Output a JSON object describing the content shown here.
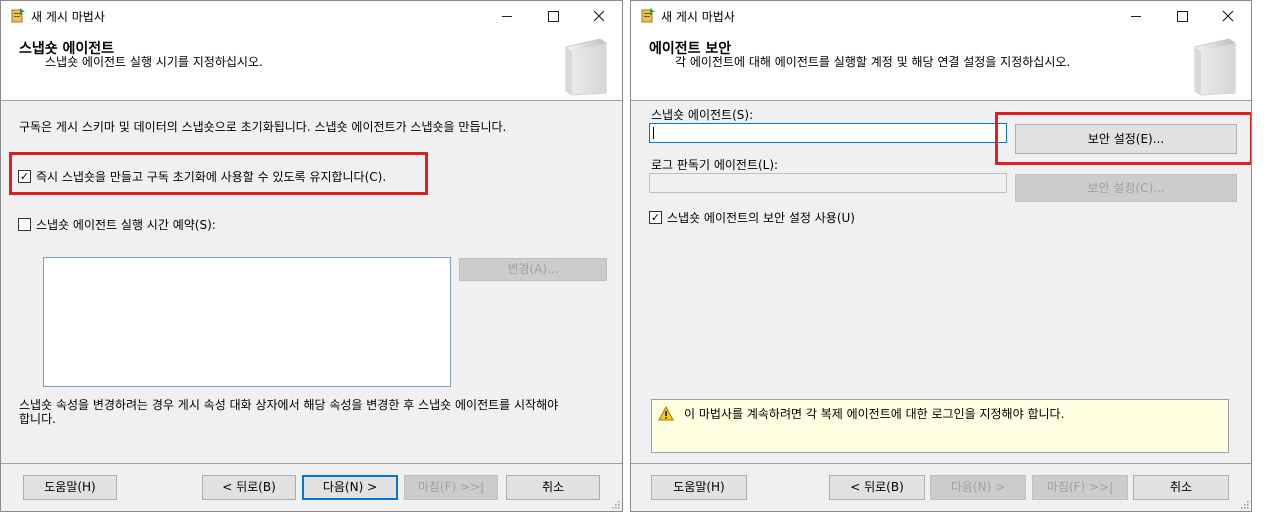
{
  "left": {
    "title": "새 게시 마법사",
    "header_title": "스냅숏 에이전트",
    "header_subtitle": "스냅숏 에이전트 실행 시기를 지정하십시오.",
    "description": "구독은 게시 스키마 및 데이터의 스냅숏으로 초기화됩니다. 스냅숏 에이전트가 스냅숏을 만듭니다.",
    "checkbox_immediate": {
      "label": "즉시 스냅숏을 만들고 구독 초기화에 사용할 수 있도록 유지합니다(C).",
      "checked": true,
      "mark": "✓"
    },
    "checkbox_schedule": {
      "label": "스냅숏 에이전트 실행 시간 예약(S):",
      "checked": false,
      "mark": ""
    },
    "change_button": "변경(A)...",
    "note_line1": "스냅숏 속성을 변경하려는 경우 게시 속성 대화 상자에서 해당 속성을 변경한 후 스냅숏 에이전트를 시작해야",
    "note_line2": "합니다.",
    "buttons": {
      "help": "도움말(H)",
      "back": "< 뒤로(B)",
      "next": "다음(N) >",
      "finish": "마침(F) >>|",
      "cancel": "취소"
    }
  },
  "right": {
    "title": "새 게시 마법사",
    "header_title": "에이전트 보안",
    "header_subtitle": "각 에이전트에 대해 에이전트를 실행할 계정 및 해당 연결 설정을 지정하십시오.",
    "snapshot_label": "스냅숏 에이전트(S):",
    "snapshot_value": "",
    "snapshot_security_button": "보안 설정(E)...",
    "logreader_label": "로그 판독기 에이전트(L):",
    "logreader_value": "",
    "logreader_security_button": "보안 설정(C)...",
    "checkbox_use_snapshot": {
      "label": "스냅숏 에이전트의 보안 설정 사용(U)",
      "checked": true,
      "mark": "✓"
    },
    "warning_text": "이 마법사를 계속하려면 각 복제 에이전트에 대한 로그인을 지정해야 합니다.",
    "buttons": {
      "help": "도움말(H)",
      "back": "< 뒤로(B)",
      "next": "다음(N) >",
      "finish": "마침(F) >>|",
      "cancel": "취소"
    }
  },
  "colors": {
    "highlight": "#e02020",
    "accent": "#0078d7",
    "warning_bg": "#ffffe1"
  }
}
